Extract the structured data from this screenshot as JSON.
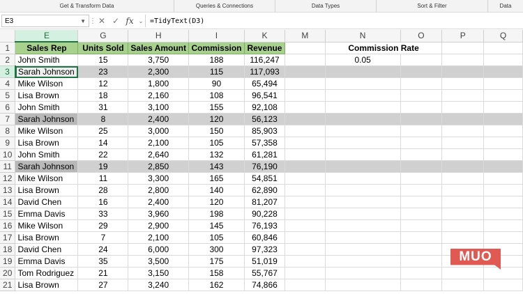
{
  "ribbon": [
    "Get & Transform Data",
    "Queries & Connections",
    "Data Types",
    "Sort & Filter",
    "Data"
  ],
  "name_box": "E3",
  "formula": "=TidyText(D3)",
  "columns": [
    "E",
    "G",
    "H",
    "I",
    "K",
    "M",
    "N",
    "O",
    "P",
    "Q"
  ],
  "headers": {
    "rep": "Sales Rep",
    "units": "Units Sold",
    "amount": "Sales Amount",
    "commission": "Commission",
    "revenue": "Revenue",
    "rate_label": "Commission Rate"
  },
  "commission_rate": "0.05",
  "rows": [
    {
      "n": "2",
      "rep": "John Smith",
      "units": "15",
      "amount": "3,750",
      "commission": "188",
      "revenue": "116,247"
    },
    {
      "n": "3",
      "rep": "Sarah Johnson",
      "units": "23",
      "amount": "2,300",
      "commission": "115",
      "revenue": "117,093"
    },
    {
      "n": "4",
      "rep": "Mike Wilson",
      "units": "12",
      "amount": "1,800",
      "commission": "90",
      "revenue": "65,494"
    },
    {
      "n": "5",
      "rep": "Lisa Brown",
      "units": "18",
      "amount": "2,160",
      "commission": "108",
      "revenue": "96,541"
    },
    {
      "n": "6",
      "rep": "John Smith",
      "units": "31",
      "amount": "3,100",
      "commission": "155",
      "revenue": "92,108"
    },
    {
      "n": "7",
      "rep": "Sarah Johnson",
      "units": "8",
      "amount": "2,400",
      "commission": "120",
      "revenue": "56,123"
    },
    {
      "n": "8",
      "rep": "Mike Wilson",
      "units": "25",
      "amount": "3,000",
      "commission": "150",
      "revenue": "85,903"
    },
    {
      "n": "9",
      "rep": "Lisa Brown",
      "units": "14",
      "amount": "2,100",
      "commission": "105",
      "revenue": "57,358"
    },
    {
      "n": "10",
      "rep": "John Smith",
      "units": "22",
      "amount": "2,640",
      "commission": "132",
      "revenue": "61,281"
    },
    {
      "n": "11",
      "rep": "Sarah Johnson",
      "units": "19",
      "amount": "2,850",
      "commission": "143",
      "revenue": "76,190"
    },
    {
      "n": "12",
      "rep": "Mike Wilson",
      "units": "11",
      "amount": "3,300",
      "commission": "165",
      "revenue": "54,851"
    },
    {
      "n": "13",
      "rep": "Lisa Brown",
      "units": "28",
      "amount": "2,800",
      "commission": "140",
      "revenue": "62,890"
    },
    {
      "n": "14",
      "rep": "David Chen",
      "units": "16",
      "amount": "2,400",
      "commission": "120",
      "revenue": "81,207"
    },
    {
      "n": "15",
      "rep": "Emma Davis",
      "units": "33",
      "amount": "3,960",
      "commission": "198",
      "revenue": "90,228"
    },
    {
      "n": "16",
      "rep": "Mike Wilson",
      "units": "29",
      "amount": "2,900",
      "commission": "145",
      "revenue": "76,193"
    },
    {
      "n": "17",
      "rep": "Lisa Brown",
      "units": "7",
      "amount": "2,100",
      "commission": "105",
      "revenue": "60,846"
    },
    {
      "n": "18",
      "rep": "David Chen",
      "units": "24",
      "amount": "6,000",
      "commission": "300",
      "revenue": "97,323"
    },
    {
      "n": "19",
      "rep": "Emma Davis",
      "units": "35",
      "amount": "3,500",
      "commission": "175",
      "revenue": "51,019"
    },
    {
      "n": "20",
      "rep": "Tom Rodriguez",
      "units": "21",
      "amount": "3,150",
      "commission": "158",
      "revenue": "55,767"
    },
    {
      "n": "21",
      "rep": "Lisa Brown",
      "units": "27",
      "amount": "3,240",
      "commission": "162",
      "revenue": "74,866"
    }
  ],
  "logo_text": "MUO"
}
